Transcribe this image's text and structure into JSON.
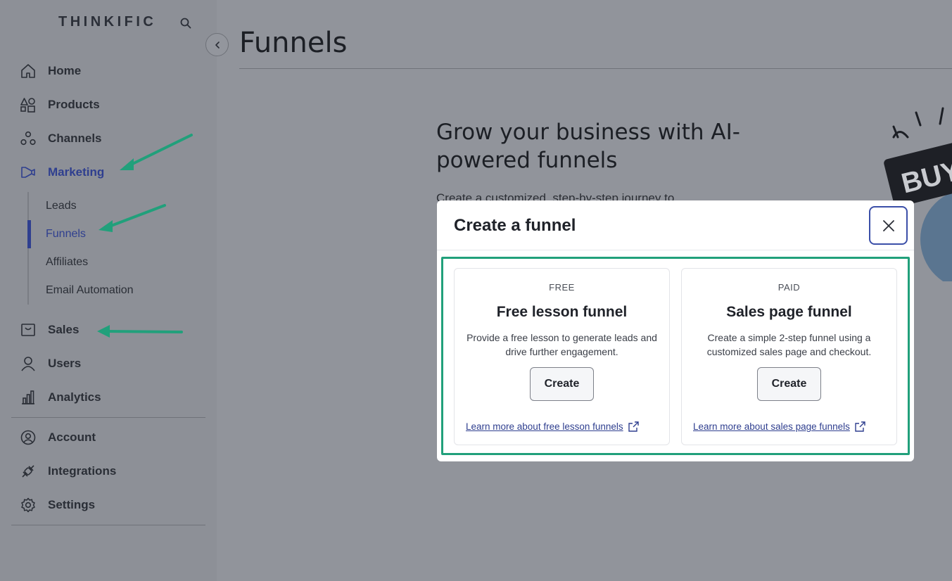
{
  "brand": {
    "name": "THINKIFIC"
  },
  "sidebar": {
    "items": [
      {
        "label": "Home",
        "icon": "home-icon"
      },
      {
        "label": "Products",
        "icon": "shapes-icon"
      },
      {
        "label": "Channels",
        "icon": "channels-icon"
      },
      {
        "label": "Marketing",
        "icon": "megaphone-icon",
        "active": true
      },
      {
        "label": "Sales",
        "icon": "sales-icon"
      },
      {
        "label": "Users",
        "icon": "user-icon"
      },
      {
        "label": "Analytics",
        "icon": "bar-chart-icon"
      },
      {
        "label": "Account",
        "icon": "account-icon"
      },
      {
        "label": "Integrations",
        "icon": "plug-icon"
      },
      {
        "label": "Settings",
        "icon": "gear-icon"
      }
    ],
    "marketing_sub": [
      {
        "label": "Leads"
      },
      {
        "label": "Funnels",
        "active": true
      },
      {
        "label": "Affiliates"
      },
      {
        "label": "Email Automation"
      }
    ]
  },
  "main": {
    "title": "Funnels",
    "hero_heading": "Grow your business with AI-powered funnels",
    "hero_sub": "Create a customized, step-by-step journey to"
  },
  "illustration": {
    "text": "BUY"
  },
  "modal": {
    "title": "Create a funnel",
    "cards": [
      {
        "tag": "FREE",
        "title": "Free lesson funnel",
        "description": "Provide a free lesson to generate leads and drive further engagement.",
        "button": "Create",
        "link": "Learn more about free lesson funnels"
      },
      {
        "tag": "PAID",
        "title": "Sales page funnel",
        "description": "Create a simple 2-step funnel using a customized sales page and checkout.",
        "button": "Create",
        "link": "Learn more about sales page funnels"
      }
    ]
  },
  "colors": {
    "accent": "#2f3f8f",
    "annotation": "#21a07b",
    "overlay": "#91949b"
  }
}
